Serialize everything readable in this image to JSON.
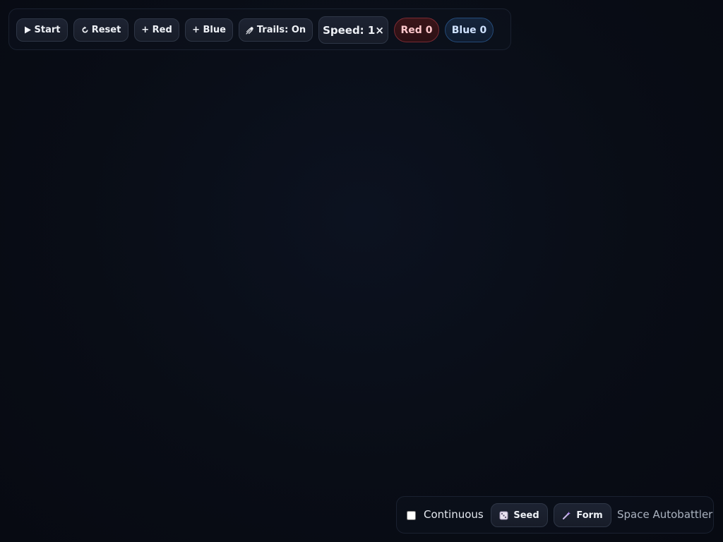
{
  "app": {
    "title": "Space Autobattler"
  },
  "toolbar": {
    "start_label": "Start",
    "reset_label": "Reset",
    "add_red_label": "+ Red",
    "add_blue_label": "+ Blue",
    "trails_label": "Trails: On",
    "speed_label": "Speed: 1×"
  },
  "score": {
    "red_label": "Red 0",
    "blue_label": "Blue 0"
  },
  "bottombar": {
    "continuous_label": "Continuous",
    "continuous_checked": false,
    "seed_label": "Seed",
    "form_label": "Form"
  },
  "icons": {
    "start": "play-icon",
    "reset": "reset-icon",
    "trails": "comet-icon",
    "seed": "dice-icon",
    "form": "wand-icon"
  },
  "colors": {
    "background": "#090d16",
    "red_team": "#ffc8cc",
    "blue_team": "#cfe2ff"
  }
}
